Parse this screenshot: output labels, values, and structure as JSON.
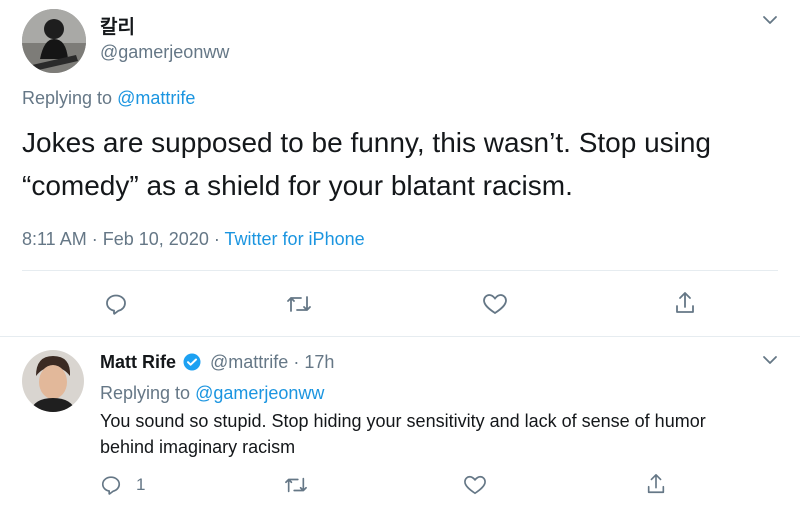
{
  "main_tweet": {
    "display_name": "칼리",
    "handle": "@gamerjeonww",
    "replying_prefix": "Replying to",
    "replying_to": "@mattrife",
    "text_line1": "Jokes are supposed to be funny, this wasn’t. Stop using",
    "text_line2": "“comedy” as a shield for your blatant racism.",
    "time": "8:11 AM",
    "date": "Feb 10, 2020",
    "source": "Twitter for iPhone",
    "separator": "·",
    "icons": [
      "chevron-down-icon",
      "reply-icon",
      "retweet-icon",
      "like-icon",
      "share-icon"
    ]
  },
  "reply_tweet": {
    "display_name": "Matt Rife",
    "handle": "@mattrife",
    "separator": "·",
    "age": "17h",
    "replying_prefix": "Replying to",
    "replying_to": "@gamerjeonww",
    "text_line1": "You sound so stupid. Stop hiding your sensitivity and lack of sense of humor",
    "text_line2": "behind imaginary racism",
    "reply_count": "1",
    "icons": [
      "verified-badge-icon",
      "chevron-down-icon",
      "reply-icon",
      "retweet-icon",
      "like-icon",
      "share-icon"
    ]
  },
  "colors": {
    "link_blue": "#1b95e0",
    "icon_blue": "#1da1f2",
    "gray": "#657786",
    "text": "#14171a",
    "divider": "#e6ecf0"
  }
}
